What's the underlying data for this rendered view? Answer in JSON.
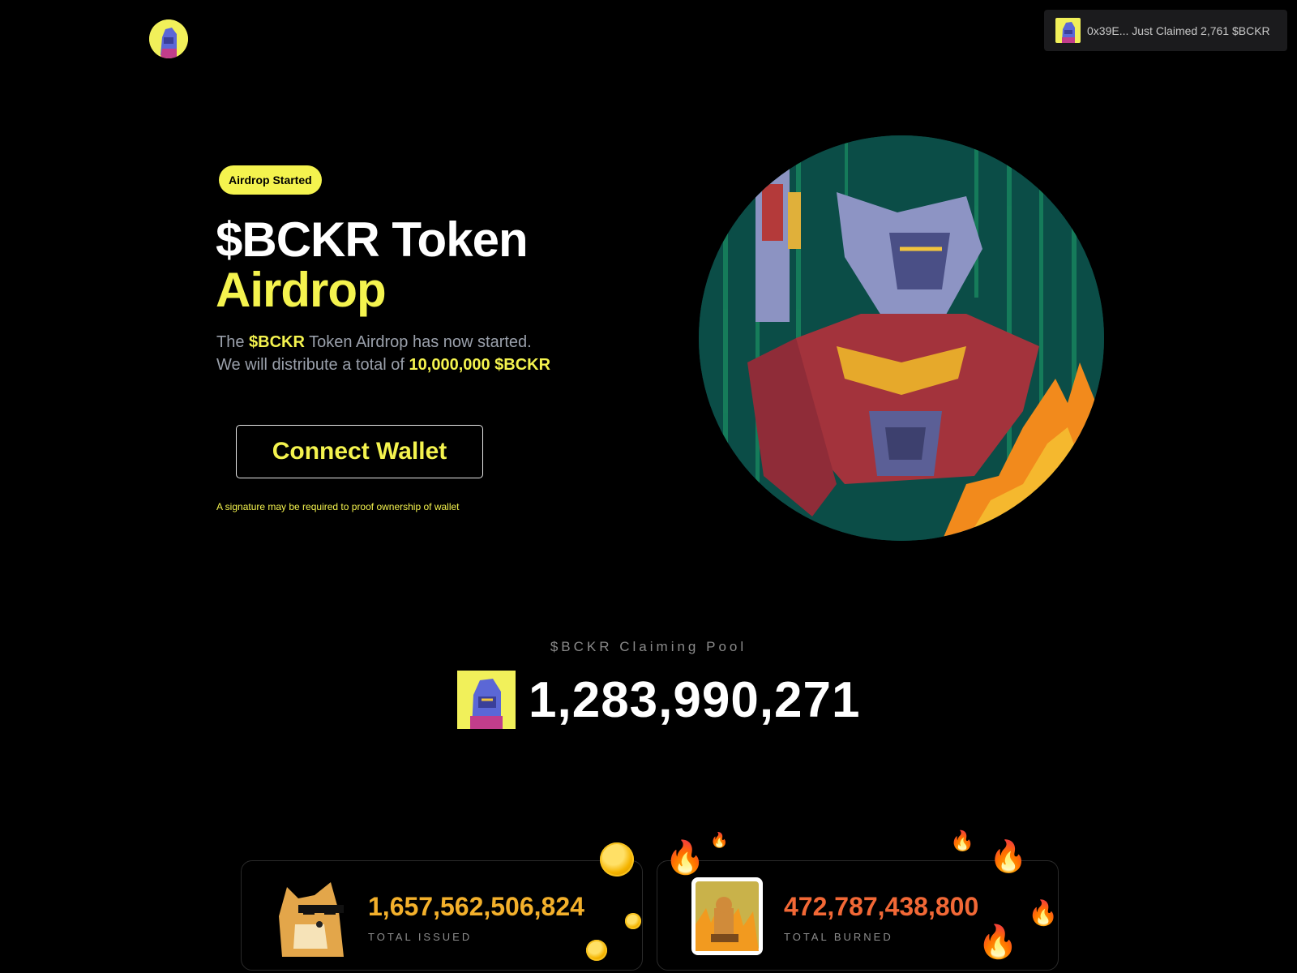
{
  "header": {
    "logo_icon": "bckr-avatar-icon",
    "toast": {
      "avatar_icon": "bckr-avatar-icon",
      "text": "0x39E... Just Claimed 2,761 $BCKR"
    }
  },
  "hero": {
    "badge": "Airdrop Started",
    "title_line1": "$BCKR Token",
    "title_line2": "Airdrop",
    "subtitle": {
      "line1_pre": "The ",
      "line1_highlight": "$BCKR",
      "line1_post": " Token Airdrop has now started.",
      "line2_pre": "We will distribute a total of ",
      "line2_highlight": "10,000,000 $BCKR"
    },
    "connect_button": "Connect Wallet",
    "note": "A signature may be required to proof ownership of wallet"
  },
  "pool": {
    "label": "$BCKR Claiming Pool",
    "value": "1,283,990,271"
  },
  "stats": {
    "issued": {
      "value": "1,657,562,506,824",
      "label": "TOTAL ISSUED",
      "icon": "doge-icon"
    },
    "burned": {
      "value": "472,787,438,800",
      "label": "TOTAL BURNED",
      "icon": "this-is-fine-dog-icon"
    }
  },
  "colors": {
    "accent_yellow": "#f4f34e",
    "issued_orange": "#f3b02b",
    "burned_orange": "#f26836",
    "background": "#000000"
  }
}
